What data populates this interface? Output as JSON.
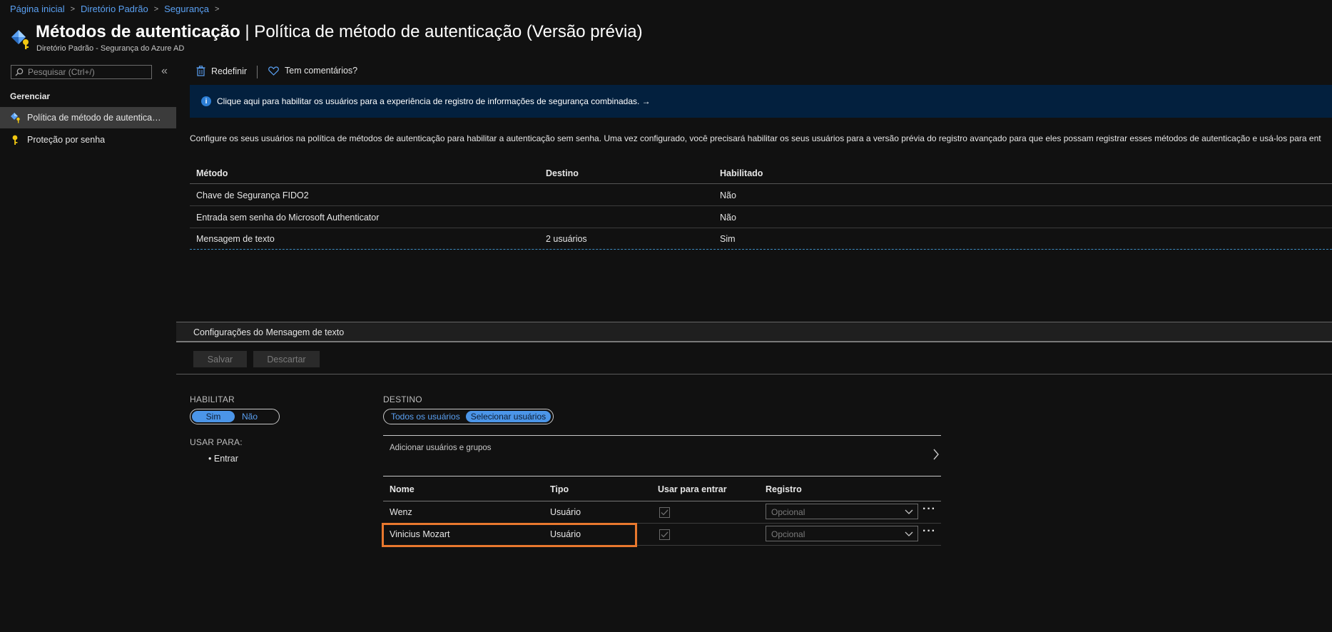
{
  "breadcrumb": [
    "Página inicial",
    "Diretório Padrão",
    "Segurança"
  ],
  "header": {
    "title_bold": "Métodos de autenticação",
    "title_rest": " | Política de método de autenticação (Versão prévia)",
    "subtitle": "Diretório Padrão - Segurança do Azure AD"
  },
  "sidebar": {
    "search_placeholder": "Pesquisar (Ctrl+/)",
    "collapse_glyph": "«",
    "section": "Gerenciar",
    "items": [
      {
        "label": "Política de método de autenticação (Versão prévia)",
        "icon": "auth-method-icon",
        "active": true
      },
      {
        "label": "Proteção por senha",
        "icon": "key-icon",
        "active": false
      }
    ]
  },
  "toolbar": {
    "reset_label": "Redefinir",
    "feedback_label": "Tem comentários?"
  },
  "banner": {
    "text": "Clique aqui para habilitar os usuários para a experiência de registro de informações de segurança combinadas. →"
  },
  "description": "Configure os seus usuários na política de métodos de autenticação para habilitar a autenticação sem senha. Uma vez configurado, você precisará habilitar os seus usuários para a versão prévia do registro avançado para que eles possam registrar esses métodos de autenticação e usá-los para ent",
  "methods_table": {
    "headers": [
      "Método",
      "Destino",
      "Habilitado"
    ],
    "rows": [
      {
        "method": "Chave de Segurança FIDO2",
        "target": "",
        "enabled": "Não"
      },
      {
        "method": "Entrada sem senha do Microsoft Authenticator",
        "target": "",
        "enabled": "Não"
      },
      {
        "method": "Mensagem de texto",
        "target": "2 usuários",
        "enabled": "Sim"
      }
    ]
  },
  "settings": {
    "title": "Configurações do Mensagem de texto",
    "save_label": "Salvar",
    "discard_label": "Descartar",
    "enable_label": "HABILITAR",
    "enable_options": [
      "Sim",
      "Não"
    ],
    "use_for_label": "USAR PARA:",
    "use_for_items": [
      "Entrar"
    ],
    "target_label": "DESTINO",
    "target_options": [
      "Todos os usuários",
      "Selecionar usuários"
    ],
    "add_users_label": "Adicionar usuários e grupos",
    "users_table": {
      "headers": [
        "Nome",
        "Tipo",
        "Usar para entrar",
        "Registro"
      ],
      "rows": [
        {
          "name": "Wenz",
          "type": "Usuário",
          "registration": "Opcional"
        },
        {
          "name": "Vinicius Mozart",
          "type": "Usuário",
          "registration": "Opcional"
        }
      ]
    },
    "more_glyph": "···"
  },
  "colors": {
    "accent": "#4b95e8",
    "link": "#5aa0f2",
    "banner_bg": "#03203e",
    "highlight": "#e8782e"
  }
}
